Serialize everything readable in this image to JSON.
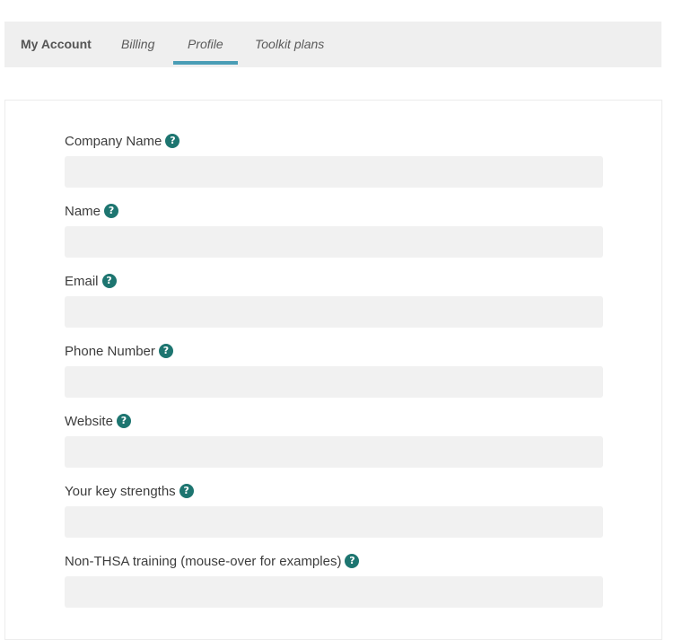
{
  "tabs": {
    "title": "My Account",
    "billing": "Billing",
    "profile": "Profile",
    "toolkit": "Toolkit plans"
  },
  "form": {
    "fields": [
      {
        "label": "Company Name",
        "value": "",
        "help_icon": "question-icon"
      },
      {
        "label": "Name",
        "value": "",
        "help_icon": "question-icon"
      },
      {
        "label": "Email",
        "value": "",
        "help_icon": "question-icon"
      },
      {
        "label": "Phone Number",
        "value": "",
        "help_icon": "question-icon"
      },
      {
        "label": "Website",
        "value": "",
        "help_icon": "question-icon"
      },
      {
        "label": "Your key strengths",
        "value": "",
        "help_icon": "question-icon"
      },
      {
        "label": "Non-THSA training (mouse-over for examples)",
        "value": "",
        "help_icon": "question-icon"
      }
    ],
    "help_glyph": "?"
  },
  "colors": {
    "accent": "#4a9db5",
    "help_badge": "#1d7570",
    "input_bg": "#f1f1f1",
    "tabbar_bg": "#efefef"
  }
}
